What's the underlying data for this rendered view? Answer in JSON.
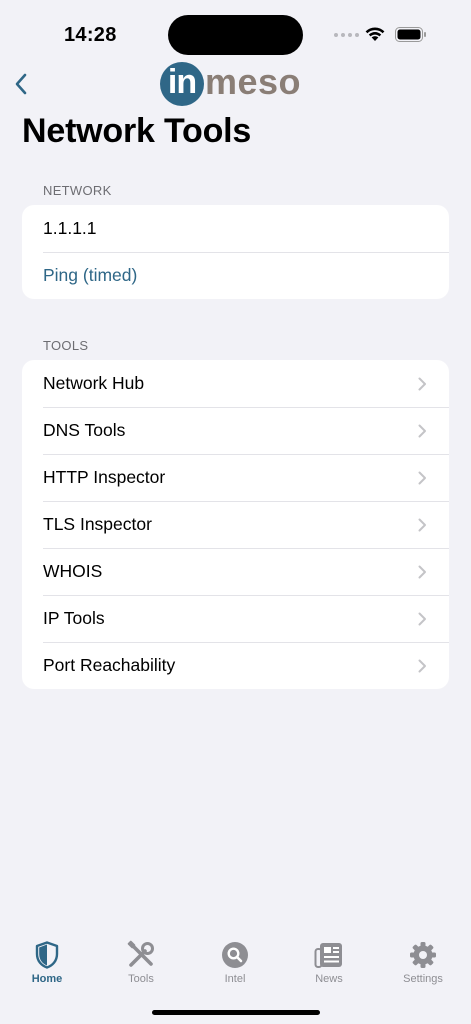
{
  "status_bar": {
    "time": "14:28",
    "icons": [
      "signal-dots-icon",
      "wifi-icon",
      "battery-icon"
    ]
  },
  "nav": {
    "back_icon": "chevron-left-icon",
    "logo_text": "inmeso",
    "logo_highlight": "in",
    "logo_rest": "meso"
  },
  "page_title": "Network Tools",
  "sections": {
    "network": {
      "header": "NETWORK",
      "rows": [
        {
          "label": "1.1.1.1",
          "style": "plain"
        },
        {
          "label": "Ping (timed)",
          "style": "link"
        }
      ]
    },
    "tools": {
      "header": "TOOLS",
      "rows": [
        {
          "label": "Network Hub"
        },
        {
          "label": "DNS Tools"
        },
        {
          "label": "HTTP Inspector"
        },
        {
          "label": "TLS Inspector"
        },
        {
          "label": "WHOIS"
        },
        {
          "label": "IP Tools"
        },
        {
          "label": "Port Reachability"
        }
      ]
    }
  },
  "tab_bar": {
    "tabs": [
      {
        "label": "Home",
        "icon": "shield-icon",
        "active": true
      },
      {
        "label": "Tools",
        "icon": "tools-icon",
        "active": false
      },
      {
        "label": "Intel",
        "icon": "search-icon",
        "active": false
      },
      {
        "label": "News",
        "icon": "newspaper-icon",
        "active": false
      },
      {
        "label": "Settings",
        "icon": "gear-icon",
        "active": false
      }
    ]
  },
  "colors": {
    "accent": "#2f6787",
    "background": "#f2f2f7",
    "inactive": "#8e8e93",
    "logo_grey": "#8a7e76"
  }
}
